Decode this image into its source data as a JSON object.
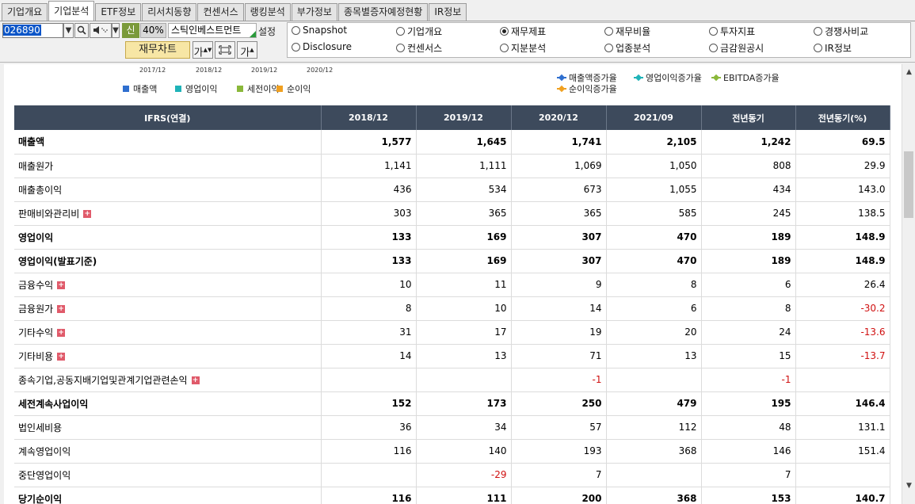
{
  "tabs": [
    {
      "label": "기업개요",
      "active": false
    },
    {
      "label": "기업분석",
      "active": true
    },
    {
      "label": "ETF정보",
      "active": false
    },
    {
      "label": "리서치동향",
      "active": false
    },
    {
      "label": "컨센서스",
      "active": false
    },
    {
      "label": "랭킹분석",
      "active": false
    },
    {
      "label": "부가정보",
      "active": false
    },
    {
      "label": "종목별증자예정현황",
      "active": false
    },
    {
      "label": "IR정보",
      "active": false
    }
  ],
  "controls": {
    "code": "026890",
    "sin": "신",
    "ratio": "40%",
    "company": "스틱인베스트먼트",
    "settings": "설정",
    "fin_chart_btn": "재무차트",
    "font_btn": "가"
  },
  "radios": [
    {
      "label": "Snapshot",
      "selected": false
    },
    {
      "label": "기업개요",
      "selected": false
    },
    {
      "label": "재무제표",
      "selected": true
    },
    {
      "label": "재무비율",
      "selected": false
    },
    {
      "label": "투자지표",
      "selected": false
    },
    {
      "label": "경쟁사비교",
      "selected": false
    },
    {
      "label": "Disclosure",
      "selected": false
    },
    {
      "label": "컨센서스",
      "selected": false
    },
    {
      "label": "지분분석",
      "selected": false
    },
    {
      "label": "업종분석",
      "selected": false
    },
    {
      "label": "금감원공시",
      "selected": false
    },
    {
      "label": "IR정보",
      "selected": false
    }
  ],
  "chart_legend": {
    "years": [
      "2017/12",
      "2018/12",
      "2019/12",
      "2020/12"
    ],
    "left": [
      {
        "label": "매출액",
        "color": "#2f6fcf"
      },
      {
        "label": "영업이익",
        "color": "#1fb3b8"
      },
      {
        "label": "세전이익",
        "color": "#8ab83a"
      },
      {
        "label": "순이익",
        "color": "#f0a020"
      }
    ],
    "right": [
      {
        "label": "매출액증가율",
        "color": "#2f6fcf"
      },
      {
        "label": "영업이익증가율",
        "color": "#1fb3b8"
      },
      {
        "label": "EBITDA증가율",
        "color": "#8ab83a"
      },
      {
        "label": "순이익증가율",
        "color": "#f0a020"
      }
    ]
  },
  "table": {
    "headers": [
      "IFRS(연결)",
      "2018/12",
      "2019/12",
      "2020/12",
      "2021/09",
      "전년동기",
      "전년동기(%)"
    ],
    "rows": [
      {
        "label": "매출액",
        "bold": true,
        "plus": false,
        "vals": [
          "1,577",
          "1,645",
          "1,741",
          "2,105",
          "1,242",
          "69.5"
        ]
      },
      {
        "label": "매출원가",
        "bold": false,
        "plus": false,
        "vals": [
          "1,141",
          "1,111",
          "1,069",
          "1,050",
          "808",
          "29.9"
        ]
      },
      {
        "label": "매출총이익",
        "bold": false,
        "plus": false,
        "vals": [
          "436",
          "534",
          "673",
          "1,055",
          "434",
          "143.0"
        ]
      },
      {
        "label": "판매비와관리비",
        "bold": false,
        "plus": true,
        "vals": [
          "303",
          "365",
          "365",
          "585",
          "245",
          "138.5"
        ]
      },
      {
        "label": "영업이익",
        "bold": true,
        "plus": false,
        "vals": [
          "133",
          "169",
          "307",
          "470",
          "189",
          "148.9"
        ]
      },
      {
        "label": "영업이익(발표기준)",
        "bold": true,
        "plus": false,
        "vals": [
          "133",
          "169",
          "307",
          "470",
          "189",
          "148.9"
        ]
      },
      {
        "label": "금융수익",
        "bold": false,
        "plus": true,
        "vals": [
          "10",
          "11",
          "9",
          "8",
          "6",
          "26.4"
        ]
      },
      {
        "label": "금융원가",
        "bold": false,
        "plus": true,
        "vals": [
          "8",
          "10",
          "14",
          "6",
          "8",
          "-30.2"
        ]
      },
      {
        "label": "기타수익",
        "bold": false,
        "plus": true,
        "vals": [
          "31",
          "17",
          "19",
          "20",
          "24",
          "-13.6"
        ]
      },
      {
        "label": "기타비용",
        "bold": false,
        "plus": true,
        "vals": [
          "14",
          "13",
          "71",
          "13",
          "15",
          "-13.7"
        ]
      },
      {
        "label": "종속기업,공동지배기업및관계기업관련손익",
        "bold": false,
        "plus": true,
        "vals": [
          "",
          "",
          "-1",
          "",
          "-1",
          ""
        ]
      },
      {
        "label": "세전계속사업이익",
        "bold": true,
        "plus": false,
        "vals": [
          "152",
          "173",
          "250",
          "479",
          "195",
          "146.4"
        ]
      },
      {
        "label": "법인세비용",
        "bold": false,
        "plus": false,
        "vals": [
          "36",
          "34",
          "57",
          "112",
          "48",
          "131.1"
        ]
      },
      {
        "label": "계속영업이익",
        "bold": false,
        "plus": false,
        "vals": [
          "116",
          "140",
          "193",
          "368",
          "146",
          "151.4"
        ]
      },
      {
        "label": "중단영업이익",
        "bold": false,
        "plus": false,
        "vals": [
          "",
          "-29",
          "7",
          "",
          "7",
          ""
        ]
      },
      {
        "label": "당기순이익",
        "bold": true,
        "plus": false,
        "vals": [
          "116",
          "111",
          "200",
          "368",
          "153",
          "140.7"
        ]
      }
    ]
  }
}
